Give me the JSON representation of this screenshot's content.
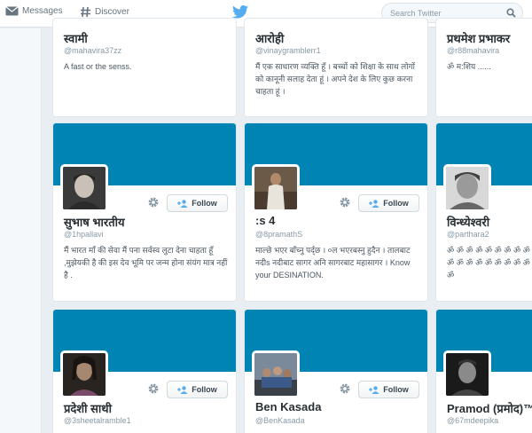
{
  "nav": {
    "messages": "Messages",
    "discover": "Discover",
    "search_placeholder": "Search Twitter"
  },
  "follow_label": "Follow",
  "colors": {
    "banner": "#0084b4",
    "background": "#e9eef2"
  },
  "row1": [
    {
      "name": "स्वामी",
      "handle": "@mahavira37zz",
      "bio": "A fast or the senss."
    },
    {
      "name": "आरोही",
      "handle": "@vinaygramblerr1",
      "bio": "मैं एक साधारण व्यक्ति हूँ । बच्चों को शिक्षा के साथ लोगों को कानूनी सलाह देता हूं । अपने देश के लिए कुछ करना चाहता हूं ।"
    },
    {
      "name": "प्रथमेश प्रभाकर",
      "handle": "@r88mahavira",
      "bio": "ॐ म:शिय ......"
    }
  ],
  "row2": [
    {
      "name": "सुभाष भारतीय",
      "handle": "@1hpallavi",
      "bio": "मैं भारत माँ की सेवा मैं पना सर्वस्व लुटा देना चाहता हूँ ,मुझेयकी है की इस देव भूमि पर जन्म होना संयंग मात्र नहीं है ."
    },
    {
      "name": ":s 4",
      "handle": "@8pramathS",
      "bio": "माल्छे भएर बाँच्नु पर्द्छ । ०ल भएरबस्नु हुदैन । तालबाट नदीs नदीबाट सागर अनि सागरबाट महासागर । Know your DESINATION."
    },
    {
      "name": "विन्ध्येश्वरी",
      "handle": "@parthara2",
      "bio": "ॐ ॐ ॐ ॐ ॐ ॐ ॐ ॐ ॐ ॐ ॐ ॐ ॐ ॐ ॐ ॐ ॐ ॐ ॐ"
    }
  ],
  "row3": [
    {
      "name": "प्रदेशी साथी",
      "handle": "@3sheetalramble1"
    },
    {
      "name": "Ben Kasada",
      "handle": "@BenKasada"
    },
    {
      "name": "Pramod (प्रमोद)™",
      "handle": "@67mdeepika"
    }
  ]
}
